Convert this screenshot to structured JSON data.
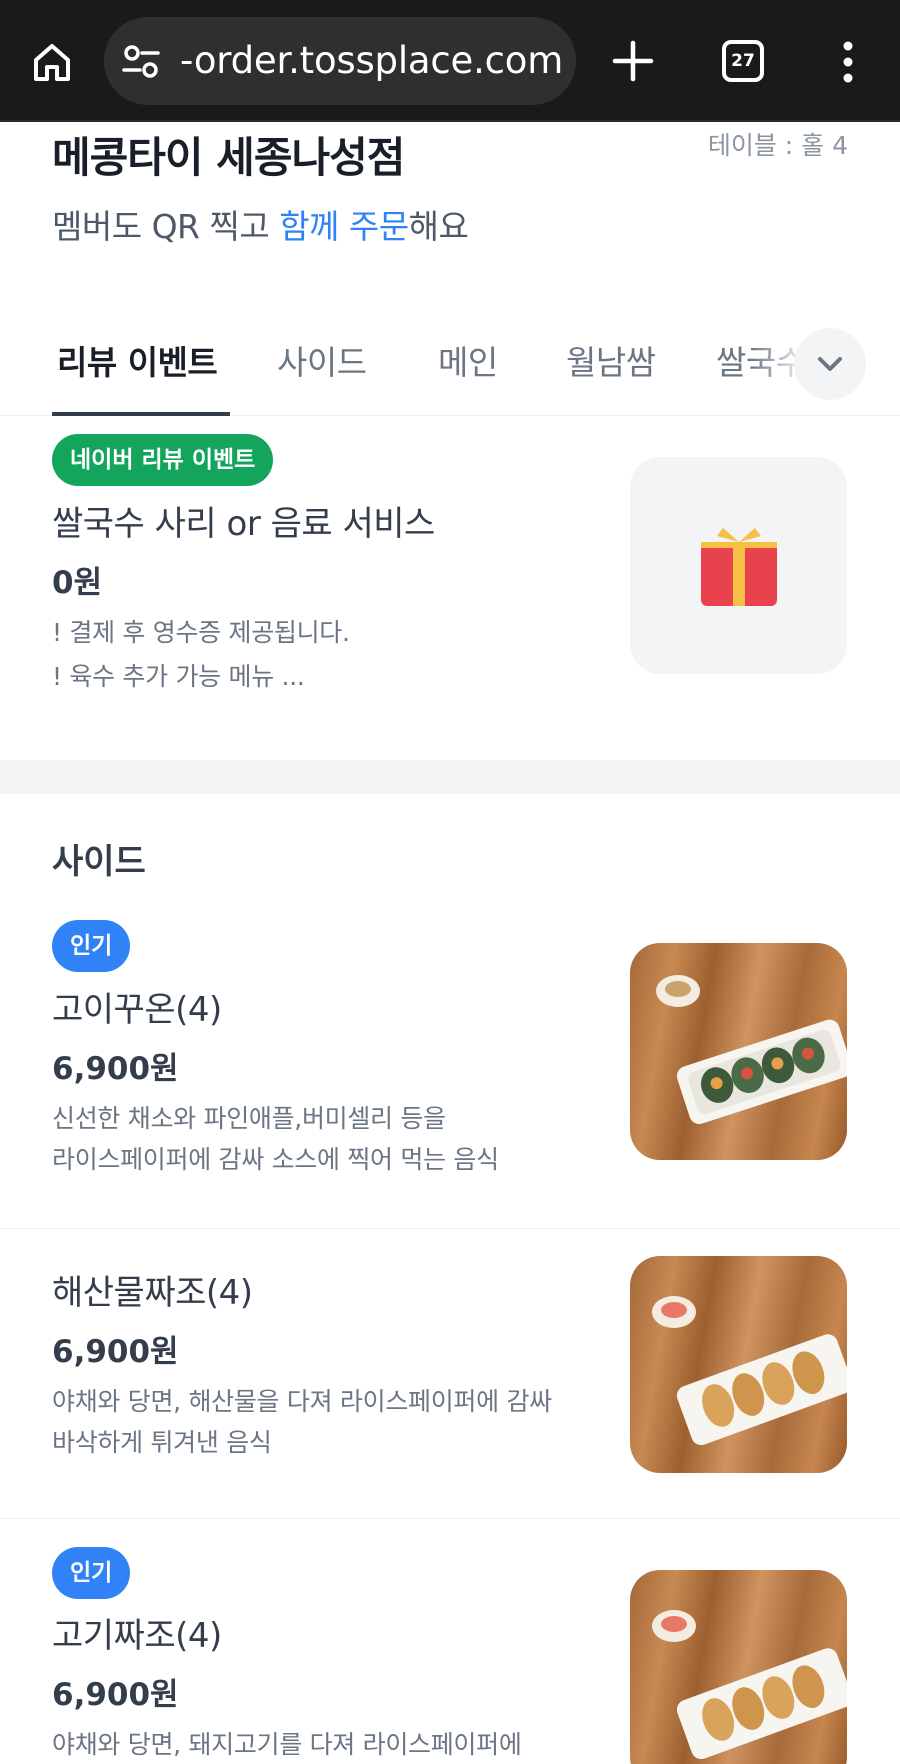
{
  "browser": {
    "url": "-order.tossplace.com",
    "tab_count": "27",
    "icons": [
      "home-icon",
      "site-settings-icon",
      "new-tab-icon",
      "tab-switcher-icon",
      "more-menu-icon"
    ]
  },
  "header": {
    "store_name": "메콩타이 세종나성점",
    "table_info": "테이블 : 홀 4",
    "subtitle_prefix": "멤버도 QR 찍고 ",
    "subtitle_highlight": "함께 주문",
    "subtitle_suffix": "해요"
  },
  "category_tabs": [
    {
      "label": "리뷰 이벤트",
      "active": true
    },
    {
      "label": "사이드",
      "active": false
    },
    {
      "label": "메인",
      "active": false
    },
    {
      "label": "월남쌈",
      "active": false
    },
    {
      "label": "쌀국수",
      "active": false
    }
  ],
  "event_item": {
    "badge": "네이버 리뷰 이벤트",
    "name": "쌀국수 사리 or 음료 서비스",
    "price": "0원",
    "desc_line1": "! 결제 후 영수증 제공됩니다.",
    "desc_line2": "! 육수 추가 가능 메뉴 ...",
    "image_icon": "gift-icon"
  },
  "section": {
    "title": "사이드"
  },
  "items": [
    {
      "badge": "인기",
      "name": "고이꾸온(4)",
      "price": "6,900원",
      "desc_line1": "신선한 채소와 파인애플,버미셀리 등을",
      "desc_line2": "라이스페이퍼에 감싸 소스에 찍어 먹는 음식"
    },
    {
      "badge": "",
      "name": "해산물짜조(4)",
      "price": "6,900원",
      "desc_line1": "야채와 당면, 해산물을 다져 라이스페이퍼에 감싸",
      "desc_line2": "바삭하게 튀겨낸 음식"
    },
    {
      "badge": "인기",
      "name": "고기짜조(4)",
      "price": "6,900원",
      "desc_line1": "야채와 당면, 돼지고기를 다져 라이스페이퍼에",
      "desc_line2": ""
    }
  ],
  "colors": {
    "accent": "#3182f6",
    "event_badge": "#14a55c",
    "chrome_bg": "#1a1a1a"
  }
}
